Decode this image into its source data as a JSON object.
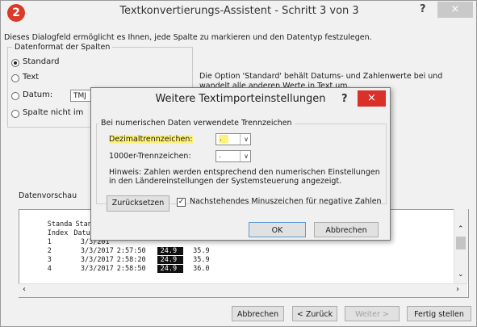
{
  "wizard": {
    "step_number": "2",
    "title": "Textkonvertierungs-Assistent - Schritt 3 von 3",
    "help": "?",
    "close": "×",
    "description": "Dieses Dialogfeld ermöglicht es Ihnen, jede Spalte zu markieren und den Datentyp festzulegen.",
    "column_format_label": "Datenformat der Spalten",
    "radios": {
      "standard": "Standard",
      "text": "Text",
      "date": "Datum:",
      "skip": "Spalte nicht im"
    },
    "date_format_value": "TMJ",
    "hint": "Die Option 'Standard' behält Datums- und Zahlenwerte bei und wandelt alle anderen Werte in Text um.",
    "preview_label": "Datenvorschau",
    "preview_rows": [
      [
        "Standa",
        "Standar",
        "",
        "",
        ""
      ],
      [
        "Index",
        "Datum",
        "",
        "",
        ""
      ],
      [
        "1",
        "3/3/201",
        "",
        "",
        ""
      ],
      [
        "2",
        "3/3/2017",
        "2:57:50",
        "24.9",
        "35.9"
      ],
      [
        "3",
        "3/3/2017",
        "2:58:20",
        "24.9",
        "35.9"
      ],
      [
        "4",
        "3/3/2017",
        "2:58:50",
        "24.9",
        "36.0"
      ]
    ],
    "buttons": {
      "cancel": "Abbrechen",
      "back": "< Zurück",
      "next": "Weiter >",
      "finish": "Fertig stellen"
    }
  },
  "dialog": {
    "title": "Weitere Textimporteinstellungen",
    "help": "?",
    "close": "×",
    "group_label": "Bei numerischen Daten verwendete Trennzeichen",
    "decimal_label": "Dezimaltrennzeichen:",
    "decimal_value": ".",
    "thousands_label": "1000er-Trennzeichen:",
    "thousands_value": ".",
    "note": "Hinweis: Zahlen werden entsprechend den numerischen Einstellungen in den Ländereinstellungen der Systemsteuerung angezeigt.",
    "reset_button": "Zurücksetzen",
    "minus_checkbox": "Nachstehendes Minuszeichen für negative Zahlen",
    "minus_checked": true,
    "ok_button": "OK",
    "cancel_button": "Abbrechen"
  }
}
